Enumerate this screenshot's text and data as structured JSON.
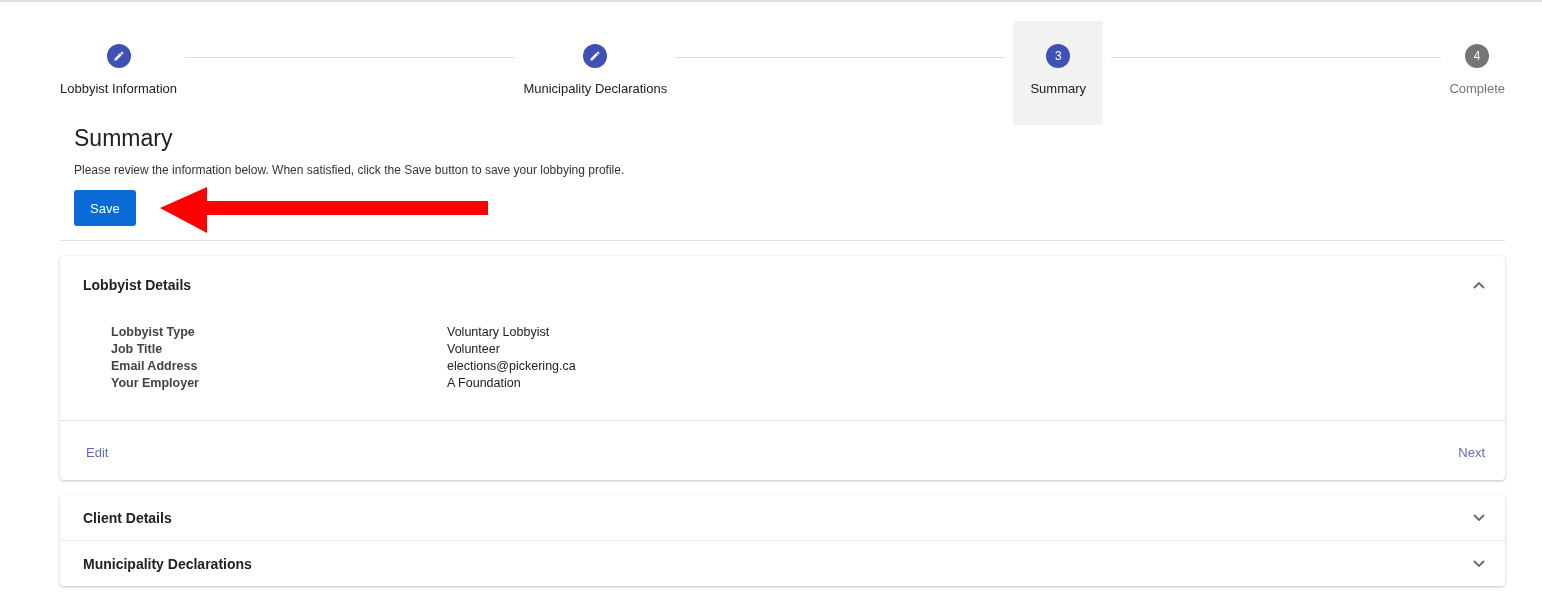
{
  "stepper": [
    {
      "label": "Lobbyist Information",
      "completed": true,
      "selected": false
    },
    {
      "label": "Municipality Declarations",
      "completed": true,
      "selected": false
    },
    {
      "label": "Summary",
      "completed": false,
      "selected": true,
      "number": "3"
    },
    {
      "label": "Complete",
      "completed": false,
      "selected": false,
      "number": "4"
    }
  ],
  "heading": "Summary",
  "intro": "Please review the information below. When satisfied, click the Save button to save your lobbying profile.",
  "save_button": "Save",
  "sections": [
    {
      "title": "Lobbyist Details",
      "expanded": true,
      "fields": [
        {
          "label": "Lobbyist Type",
          "value": "Voluntary Lobbyist"
        },
        {
          "label": "Job Title",
          "value": "Volunteer"
        },
        {
          "label": "Email Address",
          "value": "elections@pickering.ca"
        },
        {
          "label": "Your Employer",
          "value": "A Foundation"
        }
      ],
      "actions": [
        "Edit",
        "Next"
      ]
    },
    {
      "title": "Client Details",
      "expanded": false
    },
    {
      "title": "Municipality Declarations",
      "expanded": false
    }
  ]
}
